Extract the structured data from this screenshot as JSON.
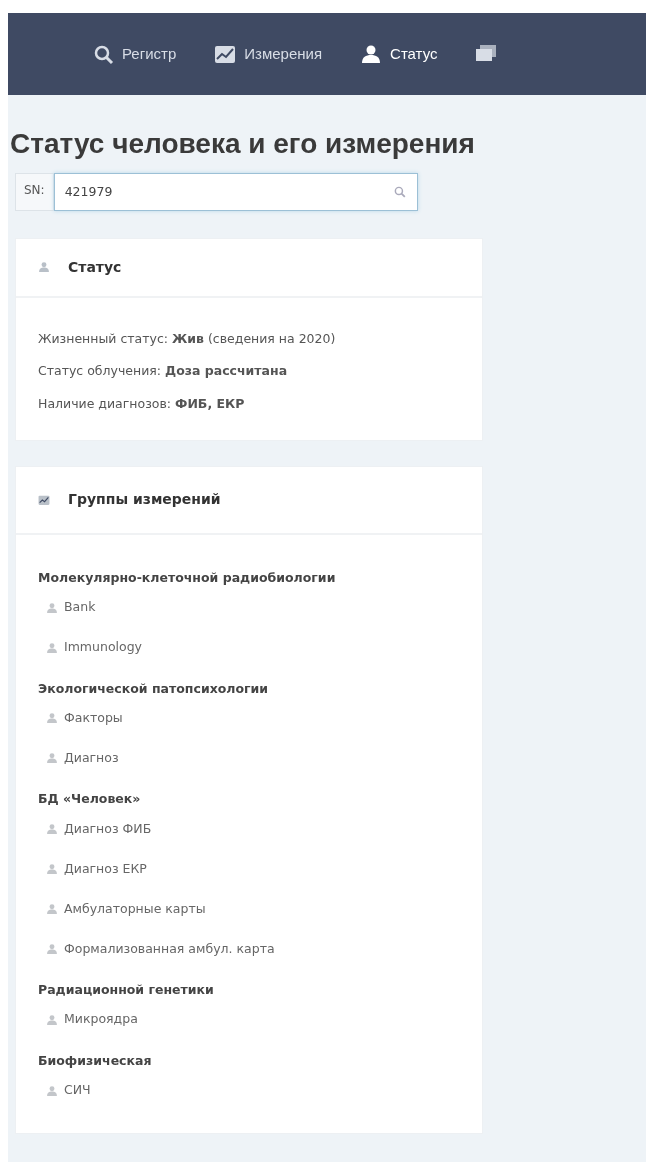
{
  "nav": [
    {
      "kind": "search",
      "label": "Регистр",
      "selected": false
    },
    {
      "kind": "chart",
      "label": "Измерения",
      "selected": false
    },
    {
      "kind": "person",
      "label": "Статус",
      "selected": true
    },
    {
      "kind": "chat"
    }
  ],
  "title": "Статус человека и его измерения",
  "sn_field": {
    "label": "SN:",
    "value": "421979"
  },
  "status_card": {
    "title": "Статус",
    "lines": [
      "Жизненный статус: **Жив** (сведения на 2020)",
      "Статус облучения: **Доза рассчитана**",
      "Наличие диагнозов: **ФИБ, ЕКР**"
    ]
  },
  "groups_card": {
    "title": "Группы измерений",
    "groups": [
      {
        "name": "Молекулярно-клеточной радиобиологии",
        "items": [
          "Bank",
          "Immunology"
        ]
      },
      {
        "name": "Экологической патопсихологии",
        "items": [
          "Факторы",
          "Диагноз"
        ]
      },
      {
        "name": "БД «Человек»",
        "items": [
          "Диагноз ФИБ",
          "Диагноз ЕКР",
          "Амбулаторные карты",
          "Формализованная амбул. карта"
        ]
      },
      {
        "name": "Радиационной генетики",
        "items": [
          "Микроядра"
        ]
      },
      {
        "name": "Биофизическая",
        "items": [
          "СИЧ"
        ]
      }
    ]
  }
}
